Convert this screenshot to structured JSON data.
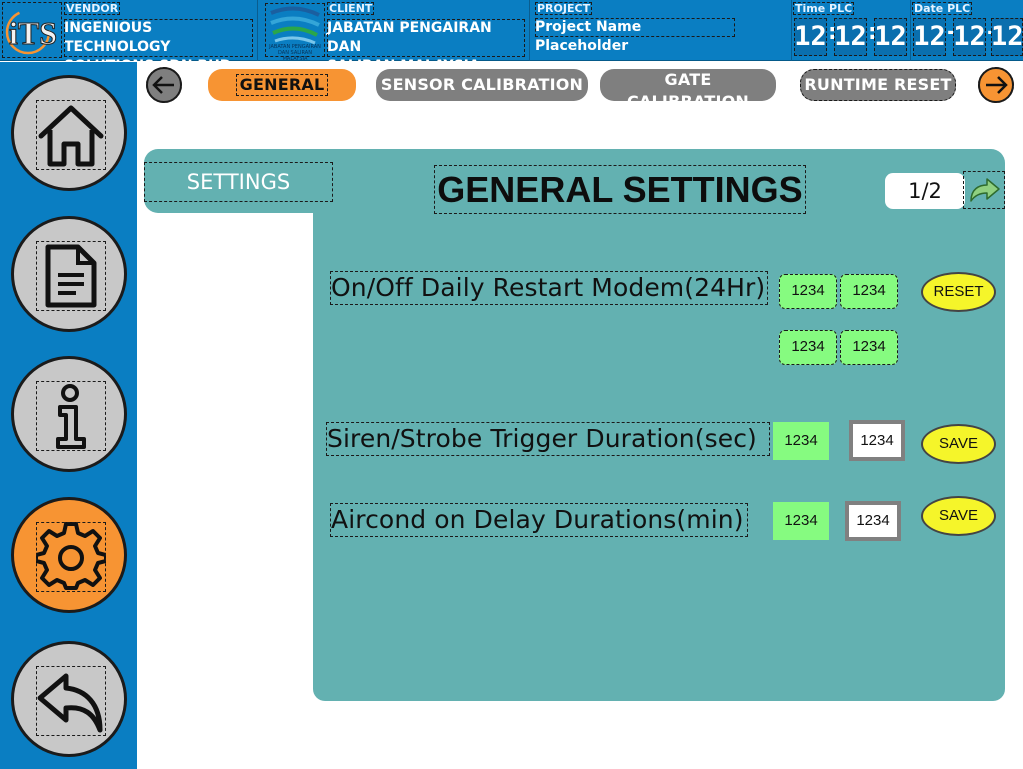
{
  "header": {
    "vendor_caption": "VENDOR",
    "vendor_name_line1": "INGENIOUS TECHNOLOGY",
    "vendor_name_line2": "SOLUTIONS SDN BHD",
    "vendor_logo_text": "iTS",
    "client_caption": "CLIENT",
    "client_name_line1": "JABATAN PENGAIRAN DAN",
    "client_name_line2": "SALIRAN MALAYSIA",
    "client_logo_text": "JABATAN PENGAIRAN DAN SALIRAN MALAYSIA",
    "project_caption": "PROJECT",
    "project_name": "Project Name Placeholder",
    "time_caption": "Time PLC",
    "time": [
      "12",
      "12",
      "12"
    ],
    "date_caption": "Date PLC",
    "date": [
      "12",
      "12",
      "12"
    ]
  },
  "sidebar": {
    "items": [
      {
        "name": "home",
        "icon": "home-icon",
        "active": false
      },
      {
        "name": "document",
        "icon": "document-icon",
        "active": false
      },
      {
        "name": "info",
        "icon": "info-icon",
        "active": false
      },
      {
        "name": "settings",
        "icon": "gear-icon",
        "active": true
      },
      {
        "name": "back",
        "icon": "reply-arrow-icon",
        "active": false
      }
    ]
  },
  "tabs": {
    "items": [
      {
        "label": "GENERAL",
        "active": true
      },
      {
        "label": "SENSOR CALIBRATION",
        "active": false
      },
      {
        "label": "GATE CALIBRATION",
        "active": false
      },
      {
        "label": "RUNTIME RESET",
        "active": false
      }
    ]
  },
  "panel": {
    "section_tab": "SETTINGS",
    "title": "GENERAL SETTINGS",
    "page_indicator": "1/2",
    "rows": [
      {
        "label": "On/Off Daily Restart Modem(24Hr)",
        "values": [
          "1234",
          "1234",
          "1234",
          "1234"
        ],
        "button": "RESET"
      },
      {
        "label": "Siren/Strobe Trigger Duration(sec)",
        "current": "1234",
        "input": "1234",
        "button": "SAVE"
      },
      {
        "label": "Aircond on Delay Durations(min)",
        "current": "1234",
        "input": "1234",
        "button": "SAVE"
      }
    ]
  },
  "colors": {
    "header_blue": "#0a7ec2",
    "active_orange": "#f79433",
    "inactive_gray": "#7f7f7f",
    "panel_teal": "#63b1b1",
    "value_green": "#86fb80",
    "button_yellow": "#f5f52a"
  }
}
